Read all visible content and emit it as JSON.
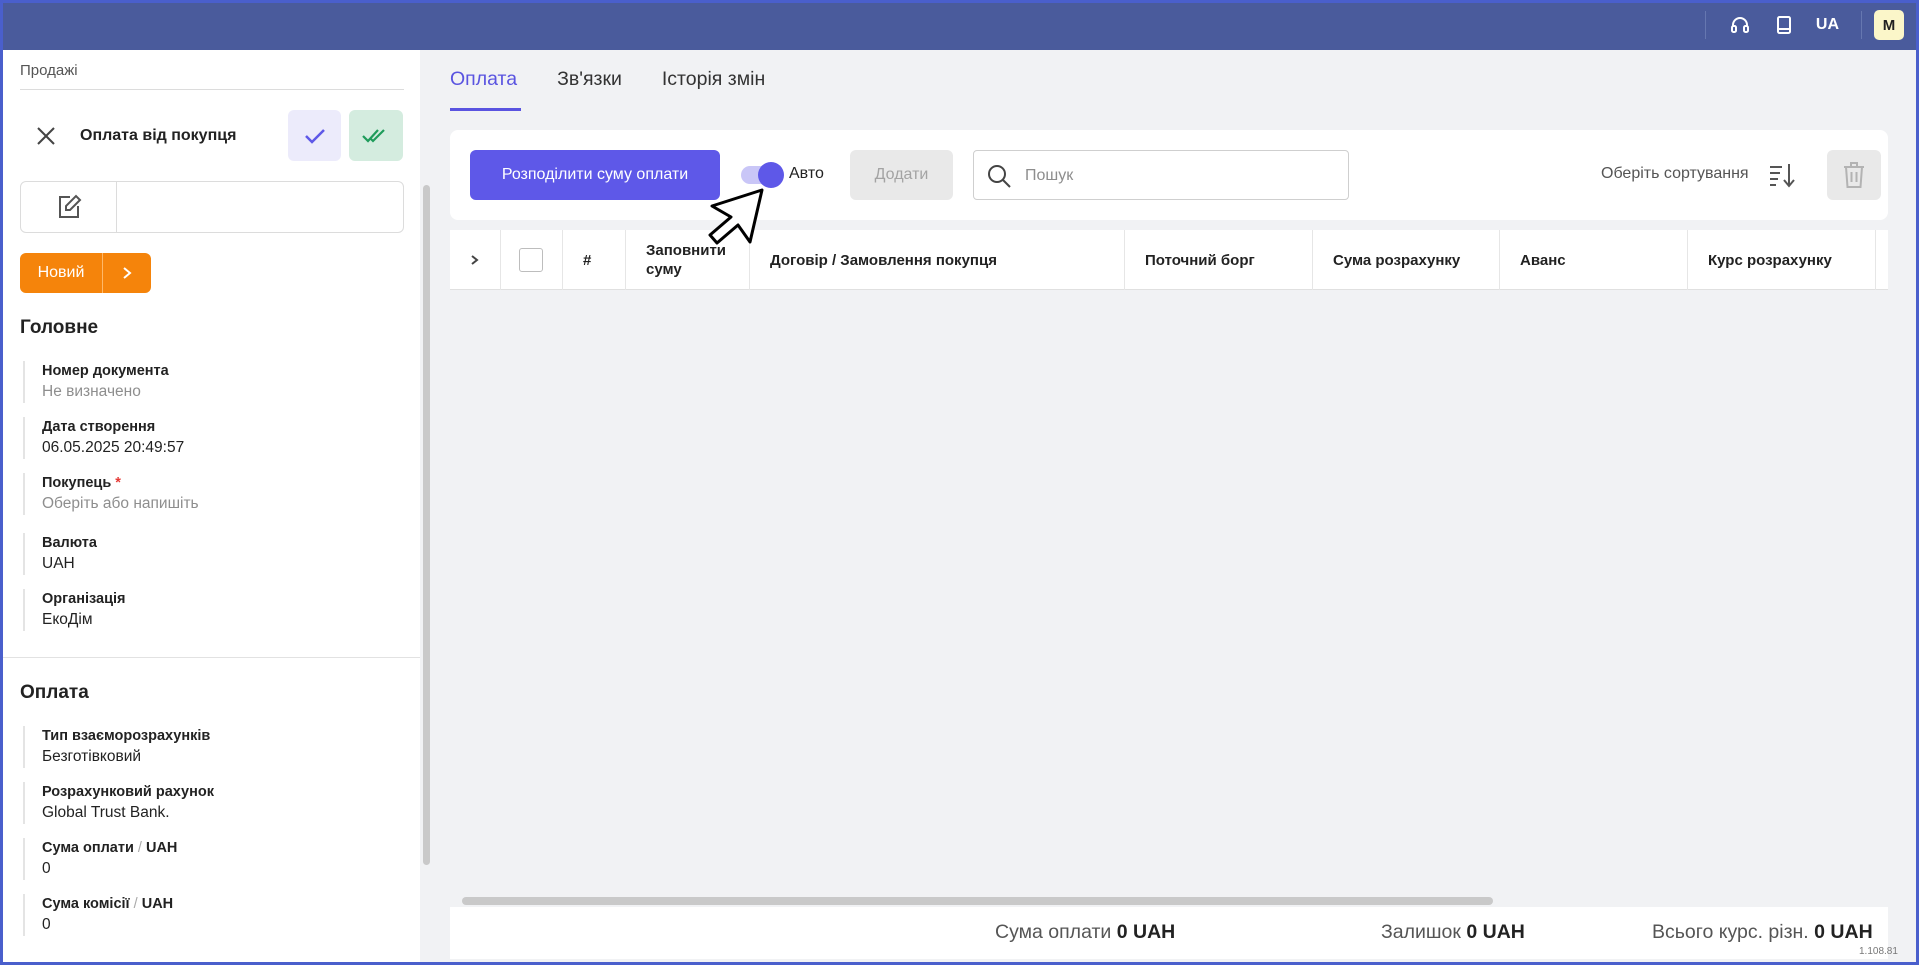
{
  "topbar": {
    "lang": "UA",
    "avatar_initial": "M",
    "icons": [
      "headset-icon",
      "book-icon"
    ]
  },
  "sidebar": {
    "breadcrumb": "Продажі",
    "doc_title": "Оплата від покупця",
    "status_label": "Новий",
    "sections": {
      "main_title": "Головне",
      "payment_title": "Оплата"
    },
    "fields": {
      "doc_number": {
        "label": "Номер документа",
        "value": "Не визначено"
      },
      "created": {
        "label": "Дата створення",
        "value": "06.05.2025 20:49:57"
      },
      "buyer": {
        "label": "Покупець",
        "required_mark": "*",
        "placeholder": "Оберіть або напишіть"
      },
      "currency": {
        "label": "Валюта",
        "value": "UAH"
      },
      "organization": {
        "label": "Організація",
        "value": "ЕкоДім"
      },
      "settlement_type": {
        "label": "Тип взаєморозрахунків",
        "value": "Безготівковий"
      },
      "account": {
        "label": "Розрахунковий рахунок",
        "value": "Global Trust Bank."
      },
      "payment_sum": {
        "label": "Сума оплати",
        "sep": " / ",
        "unit": "UAH",
        "value": "0"
      },
      "commission_sum": {
        "label": "Сума комісії",
        "sep": " / ",
        "unit": "UAH",
        "value": "0"
      }
    }
  },
  "tabs": [
    {
      "label": "Оплата",
      "active": true
    },
    {
      "label": "Зв'язки",
      "active": false
    },
    {
      "label": "Історія змін",
      "active": false
    }
  ],
  "toolbar": {
    "distribute_label": "Розподілити суму оплати",
    "auto_label": "Авто",
    "auto_on": true,
    "add_label": "Додати",
    "search_placeholder": "Пошук",
    "sort_label": "Оберіть сортування"
  },
  "table": {
    "columns": [
      "#",
      "Заповнити суму",
      "Договір / Замовлення покупця",
      "Поточний борг",
      "Сума розрахунку",
      "Аванс",
      "Курс розрахунку"
    ],
    "rows": []
  },
  "footer": {
    "payment_label": "Сума оплати",
    "payment_value": "0 UAH",
    "remainder_label": "Залишок",
    "remainder_value": "0 UAH",
    "rate_diff_label": "Всього курс. різн.",
    "rate_diff_value": "0 UAH",
    "version": "1.108.81"
  },
  "colors": {
    "topbar": "#4a5b9c",
    "accent": "#5e58e8",
    "status": "#f5840b",
    "confirm_green": "#d4ecdf"
  }
}
